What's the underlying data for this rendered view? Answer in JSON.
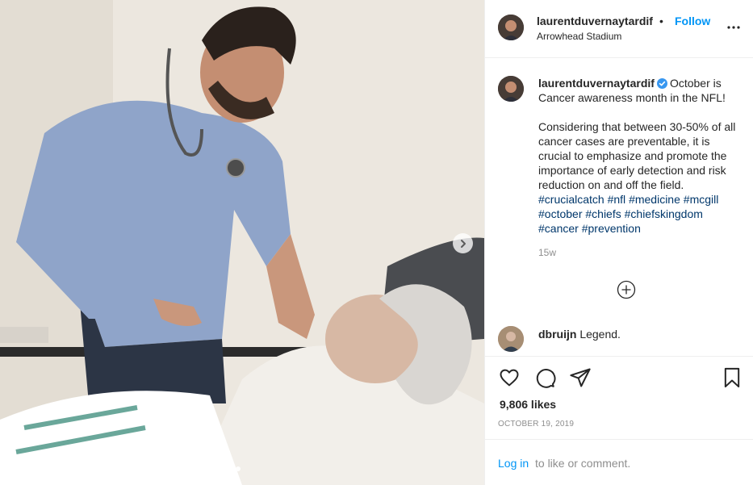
{
  "post": {
    "photo_alt": "Doctor smiling at elderly patient in hospital bed",
    "carousel_next_icon": "chevron-right-icon"
  },
  "header": {
    "username": "laurentduvernaytardif",
    "separator": "•",
    "follow_label": "Follow",
    "location": "Arrowhead Stadium",
    "more_icon": "more-options-icon"
  },
  "caption": {
    "username": "laurentduvernaytardif",
    "line1": "October is Cancer awareness month in the NFL!",
    "line2": "Considering that between 30-50% of all cancer cases are preventable, it is crucial to emphasize and promote the importance of early detection and risk reduction on and off the field.",
    "hashtags": [
      "#crucialcatch",
      "#nfl",
      "#medicine",
      "#mcgill",
      "#october",
      "#chiefs",
      "#chiefskingdom",
      "#cancer",
      "#prevention"
    ],
    "age": "15w"
  },
  "comment": {
    "username": "dbruijn",
    "text": "Legend."
  },
  "stats": {
    "likes": "9,806 likes",
    "date": "October 19, 2019"
  },
  "login": {
    "link": "Log in",
    "rest": "to like or comment."
  },
  "colors": {
    "accent": "#0095f6",
    "hashtag": "#00376b",
    "muted": "#8e8e8e",
    "verified": "#3897f0"
  }
}
